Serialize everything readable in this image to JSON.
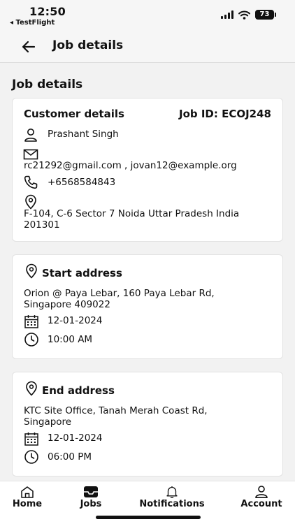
{
  "status_bar": {
    "time": "12:50",
    "back_app": "◂ TestFlight",
    "battery": "73"
  },
  "header": {
    "title": "Job details"
  },
  "section_title": "Job details",
  "customer": {
    "heading": "Customer details",
    "job_id": "Job ID: ECOJ248",
    "name": "Prashant Singh",
    "emails": "rc21292@gmail.com , jovan12@example.org",
    "phone": "+6568584843",
    "address_line1": "F-104, C-6 Sector 7 Noida Uttar Pradesh India",
    "address_line2": "201301"
  },
  "start": {
    "heading": "Start address",
    "address_line1": "Orion @ Paya Lebar, 160 Paya Lebar Rd,",
    "address_line2": "Singapore 409022",
    "date": "12-01-2024",
    "time": "10:00 AM"
  },
  "end": {
    "heading": "End address",
    "address_line1": "KTC Site Office, Tanah Merah Coast Rd,",
    "address_line2": "Singapore",
    "date": "12-01-2024",
    "time": "06:00 PM"
  },
  "nav": {
    "home": "Home",
    "jobs": "Jobs",
    "notifications": "Notifications",
    "account": "Account"
  }
}
